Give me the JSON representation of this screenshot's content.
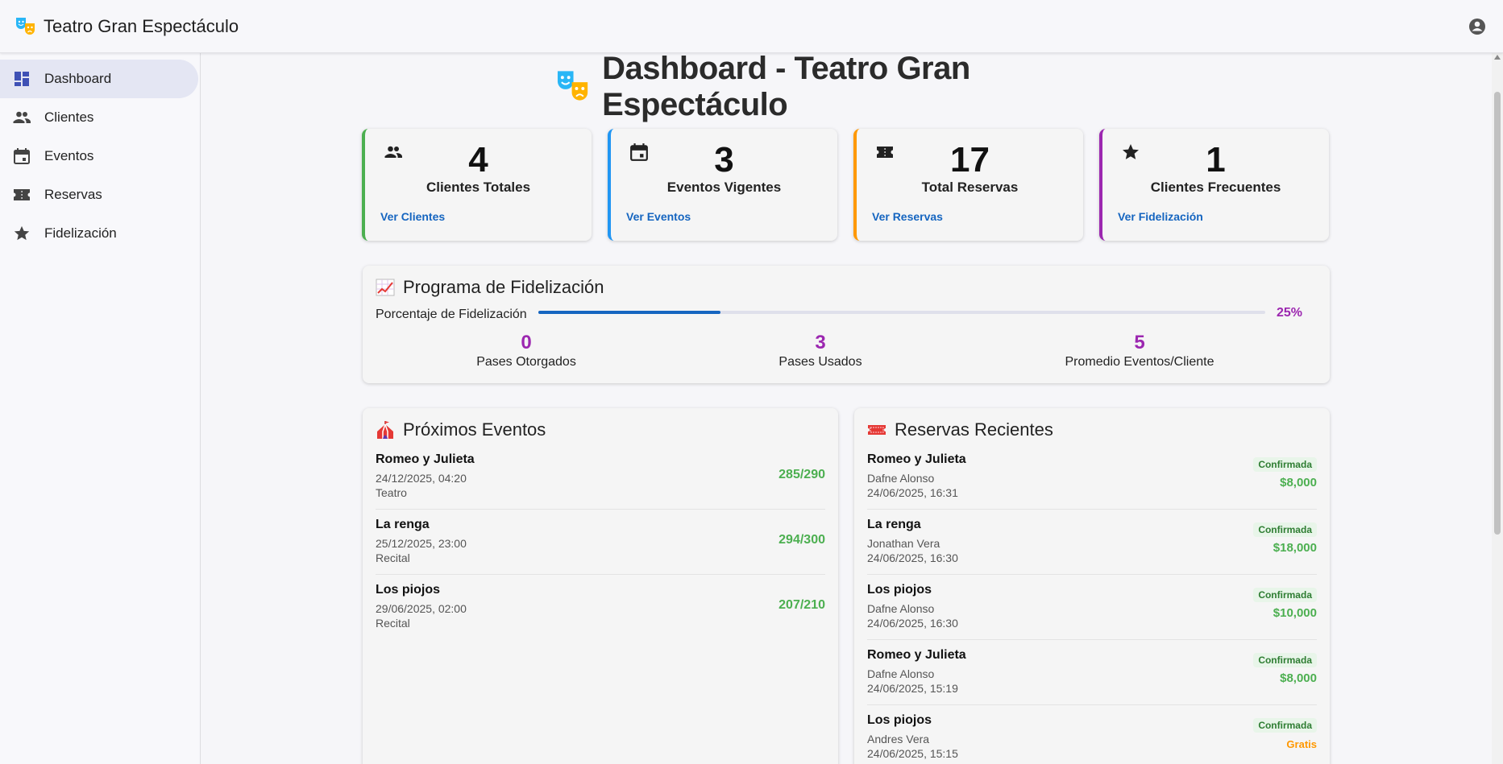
{
  "app": {
    "title": "Teatro Gran Espectáculo",
    "account_icon": "account-circle-icon"
  },
  "sidebar": {
    "items": [
      {
        "label": "Dashboard",
        "icon": "dashboard-icon",
        "active": true
      },
      {
        "label": "Clientes",
        "icon": "people-icon"
      },
      {
        "label": "Eventos",
        "icon": "calendar-icon"
      },
      {
        "label": "Reservas",
        "icon": "ticket-icon"
      },
      {
        "label": "Fidelización",
        "icon": "star-icon"
      }
    ]
  },
  "page": {
    "title": "Dashboard - Teatro Gran Espectáculo",
    "icon": "theater-masks-icon"
  },
  "stats": [
    {
      "value": "4",
      "label": "Clientes Totales",
      "link": "Ver Clientes",
      "icon": "people-icon",
      "color": "#4caf50"
    },
    {
      "value": "3",
      "label": "Eventos Vigentes",
      "link": "Ver Eventos",
      "icon": "calendar-icon",
      "color": "#2196f3"
    },
    {
      "value": "17",
      "label": "Total Reservas",
      "link": "Ver Reservas",
      "icon": "ticket-icon",
      "color": "#ff9800"
    },
    {
      "value": "1",
      "label": "Clientes Frecuentes",
      "link": "Ver Fidelización",
      "icon": "star-icon",
      "color": "#9c27b0"
    }
  ],
  "fidelizacion": {
    "title": "Programa de Fidelización",
    "icon": "chart-increasing-icon",
    "progress_label": "Porcentaje de Fidelización",
    "progress_value": 25,
    "progress_text": "25%",
    "stats": [
      {
        "value": "0",
        "label": "Pases Otorgados"
      },
      {
        "value": "3",
        "label": "Pases Usados"
      },
      {
        "value": "5",
        "label": "Promedio Eventos/Cliente"
      }
    ]
  },
  "proximos": {
    "title": "Próximos Eventos",
    "icon": "circus-tent-icon",
    "items": [
      {
        "name": "Romeo y Julieta",
        "date": "24/12/2025, 04:20",
        "type": "Teatro",
        "capacity": "285/290"
      },
      {
        "name": "La renga",
        "date": "25/12/2025, 23:00",
        "type": "Recital",
        "capacity": "294/300"
      },
      {
        "name": "Los piojos",
        "date": "29/06/2025, 02:00",
        "type": "Recital",
        "capacity": "207/210"
      }
    ]
  },
  "reservas": {
    "title": "Reservas Recientes",
    "icon": "ticket-icon",
    "items": [
      {
        "event": "Romeo y Julieta",
        "client": "Dafne Alonso",
        "date": "24/06/2025, 16:31",
        "status": "Confirmada",
        "price": "$8,000"
      },
      {
        "event": "La renga",
        "client": "Jonathan Vera",
        "date": "24/06/2025, 16:30",
        "status": "Confirmada",
        "price": "$18,000"
      },
      {
        "event": "Los piojos",
        "client": "Dafne Alonso",
        "date": "24/06/2025, 16:30",
        "status": "Confirmada",
        "price": "$10,000"
      },
      {
        "event": "Romeo y Julieta",
        "client": "Dafne Alonso",
        "date": "24/06/2025, 15:19",
        "status": "Confirmada",
        "price": "$8,000"
      },
      {
        "event": "Los piojos",
        "client": "Andres Vera",
        "date": "24/06/2025, 15:15",
        "status": "Confirmada",
        "price": "Gratis"
      }
    ]
  },
  "colors": {
    "accent": "#1565c0",
    "purple": "#9c27b0",
    "green": "#4caf50",
    "orange": "#ff9800",
    "blue": "#2196f3"
  }
}
